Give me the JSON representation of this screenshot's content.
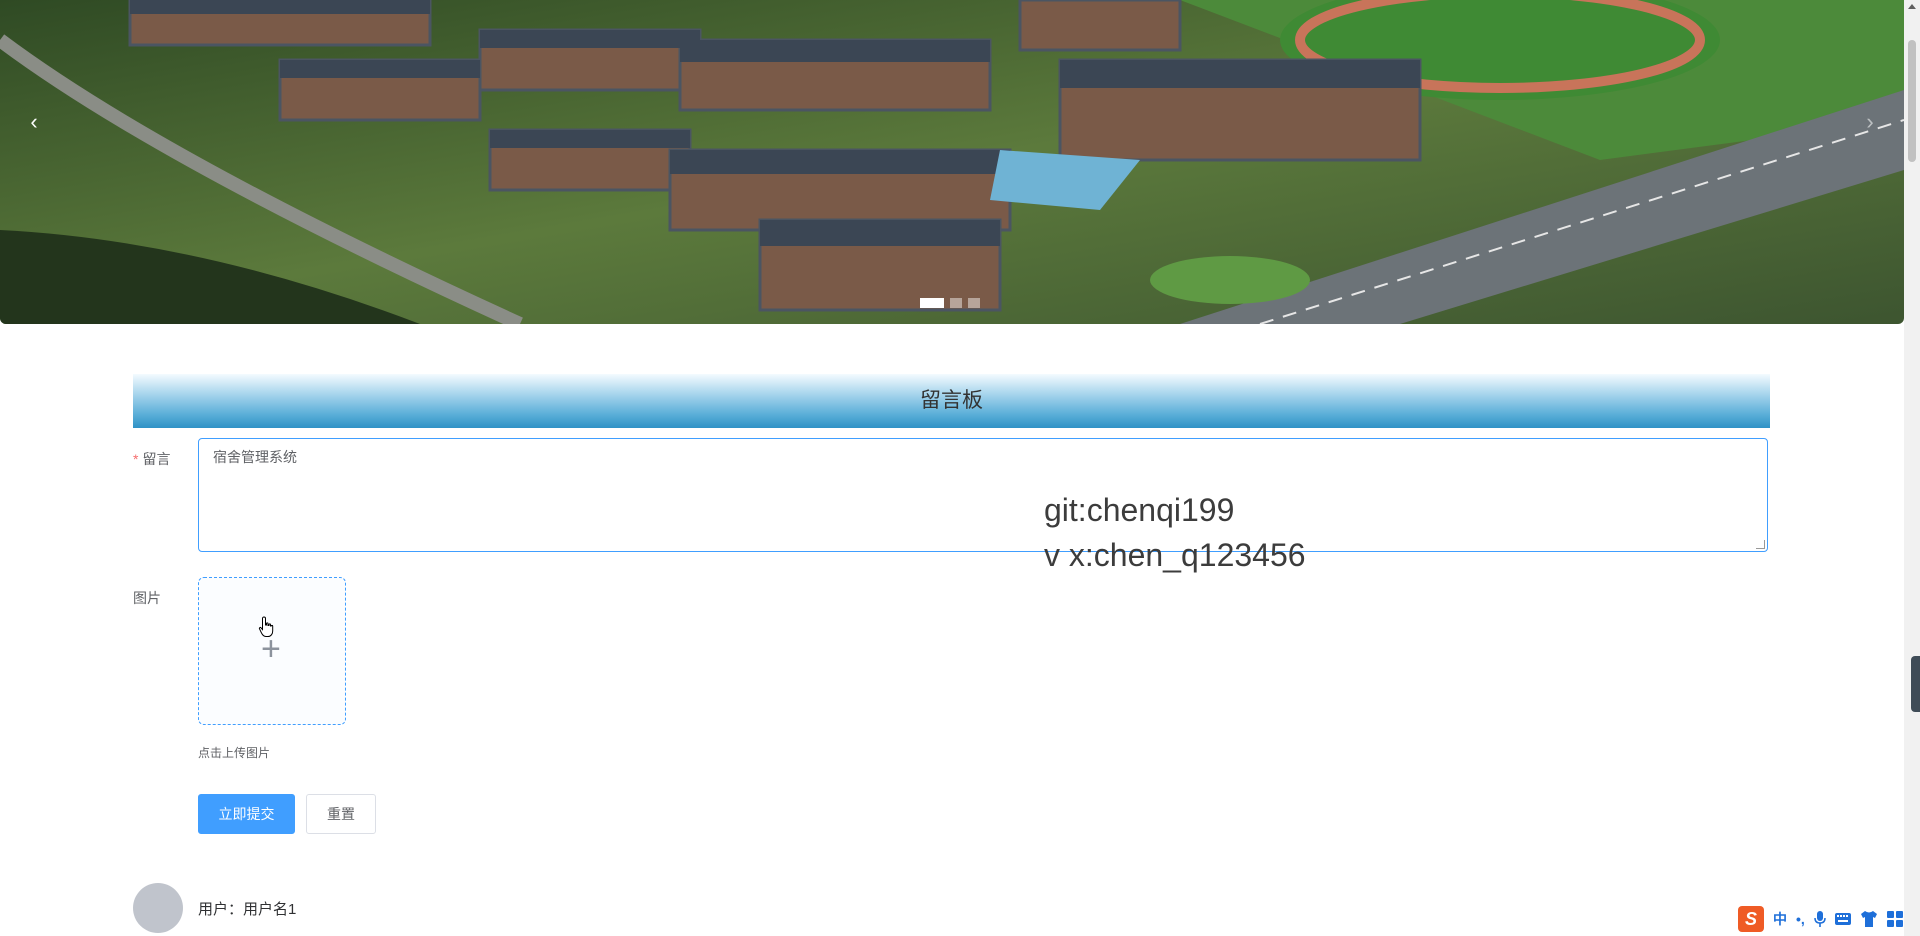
{
  "carousel": {
    "prev_icon": "chevron-left-icon",
    "next_icon": "chevron-right-icon",
    "prev_label": "‹",
    "next_label": "›",
    "slide_count": 3,
    "active_slide": 1
  },
  "board": {
    "title": "留言板",
    "message_label": "留言",
    "required_mark": "*",
    "message_value": "宿舍管理系统",
    "image_label": "图片",
    "upload_plus": "+",
    "upload_tip": "点击上传图片",
    "submit_label": "立即提交",
    "reset_label": "重置"
  },
  "watermark": {
    "line1": "git:chenqi199",
    "line2": "v x:chen_q123456"
  },
  "comments": [
    {
      "user_text": "用户：用户名1"
    }
  ],
  "ime": {
    "logo": "S",
    "mode": "中",
    "punct": "•,",
    "icons": [
      "mic-icon",
      "keyboard-icon",
      "shirt-icon",
      "grid-icon"
    ]
  },
  "colors": {
    "primary": "#409eff",
    "header_gradient_bottom": "#2f92c6",
    "required": "#f56c6c"
  }
}
